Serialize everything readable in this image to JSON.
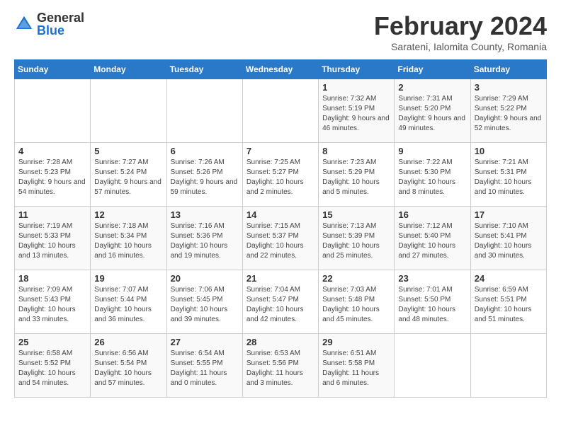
{
  "logo": {
    "general": "General",
    "blue": "Blue"
  },
  "header": {
    "month": "February 2024",
    "location": "Sarateni, Ialomita County, Romania"
  },
  "days_of_week": [
    "Sunday",
    "Monday",
    "Tuesday",
    "Wednesday",
    "Thursday",
    "Friday",
    "Saturday"
  ],
  "weeks": [
    [
      {
        "day": "",
        "info": ""
      },
      {
        "day": "",
        "info": ""
      },
      {
        "day": "",
        "info": ""
      },
      {
        "day": "",
        "info": ""
      },
      {
        "day": "1",
        "info": "Sunrise: 7:32 AM\nSunset: 5:19 PM\nDaylight: 9 hours and 46 minutes."
      },
      {
        "day": "2",
        "info": "Sunrise: 7:31 AM\nSunset: 5:20 PM\nDaylight: 9 hours and 49 minutes."
      },
      {
        "day": "3",
        "info": "Sunrise: 7:29 AM\nSunset: 5:22 PM\nDaylight: 9 hours and 52 minutes."
      }
    ],
    [
      {
        "day": "4",
        "info": "Sunrise: 7:28 AM\nSunset: 5:23 PM\nDaylight: 9 hours and 54 minutes."
      },
      {
        "day": "5",
        "info": "Sunrise: 7:27 AM\nSunset: 5:24 PM\nDaylight: 9 hours and 57 minutes."
      },
      {
        "day": "6",
        "info": "Sunrise: 7:26 AM\nSunset: 5:26 PM\nDaylight: 9 hours and 59 minutes."
      },
      {
        "day": "7",
        "info": "Sunrise: 7:25 AM\nSunset: 5:27 PM\nDaylight: 10 hours and 2 minutes."
      },
      {
        "day": "8",
        "info": "Sunrise: 7:23 AM\nSunset: 5:29 PM\nDaylight: 10 hours and 5 minutes."
      },
      {
        "day": "9",
        "info": "Sunrise: 7:22 AM\nSunset: 5:30 PM\nDaylight: 10 hours and 8 minutes."
      },
      {
        "day": "10",
        "info": "Sunrise: 7:21 AM\nSunset: 5:31 PM\nDaylight: 10 hours and 10 minutes."
      }
    ],
    [
      {
        "day": "11",
        "info": "Sunrise: 7:19 AM\nSunset: 5:33 PM\nDaylight: 10 hours and 13 minutes."
      },
      {
        "day": "12",
        "info": "Sunrise: 7:18 AM\nSunset: 5:34 PM\nDaylight: 10 hours and 16 minutes."
      },
      {
        "day": "13",
        "info": "Sunrise: 7:16 AM\nSunset: 5:36 PM\nDaylight: 10 hours and 19 minutes."
      },
      {
        "day": "14",
        "info": "Sunrise: 7:15 AM\nSunset: 5:37 PM\nDaylight: 10 hours and 22 minutes."
      },
      {
        "day": "15",
        "info": "Sunrise: 7:13 AM\nSunset: 5:39 PM\nDaylight: 10 hours and 25 minutes."
      },
      {
        "day": "16",
        "info": "Sunrise: 7:12 AM\nSunset: 5:40 PM\nDaylight: 10 hours and 27 minutes."
      },
      {
        "day": "17",
        "info": "Sunrise: 7:10 AM\nSunset: 5:41 PM\nDaylight: 10 hours and 30 minutes."
      }
    ],
    [
      {
        "day": "18",
        "info": "Sunrise: 7:09 AM\nSunset: 5:43 PM\nDaylight: 10 hours and 33 minutes."
      },
      {
        "day": "19",
        "info": "Sunrise: 7:07 AM\nSunset: 5:44 PM\nDaylight: 10 hours and 36 minutes."
      },
      {
        "day": "20",
        "info": "Sunrise: 7:06 AM\nSunset: 5:45 PM\nDaylight: 10 hours and 39 minutes."
      },
      {
        "day": "21",
        "info": "Sunrise: 7:04 AM\nSunset: 5:47 PM\nDaylight: 10 hours and 42 minutes."
      },
      {
        "day": "22",
        "info": "Sunrise: 7:03 AM\nSunset: 5:48 PM\nDaylight: 10 hours and 45 minutes."
      },
      {
        "day": "23",
        "info": "Sunrise: 7:01 AM\nSunset: 5:50 PM\nDaylight: 10 hours and 48 minutes."
      },
      {
        "day": "24",
        "info": "Sunrise: 6:59 AM\nSunset: 5:51 PM\nDaylight: 10 hours and 51 minutes."
      }
    ],
    [
      {
        "day": "25",
        "info": "Sunrise: 6:58 AM\nSunset: 5:52 PM\nDaylight: 10 hours and 54 minutes."
      },
      {
        "day": "26",
        "info": "Sunrise: 6:56 AM\nSunset: 5:54 PM\nDaylight: 10 hours and 57 minutes."
      },
      {
        "day": "27",
        "info": "Sunrise: 6:54 AM\nSunset: 5:55 PM\nDaylight: 11 hours and 0 minutes."
      },
      {
        "day": "28",
        "info": "Sunrise: 6:53 AM\nSunset: 5:56 PM\nDaylight: 11 hours and 3 minutes."
      },
      {
        "day": "29",
        "info": "Sunrise: 6:51 AM\nSunset: 5:58 PM\nDaylight: 11 hours and 6 minutes."
      },
      {
        "day": "",
        "info": ""
      },
      {
        "day": "",
        "info": ""
      }
    ]
  ]
}
